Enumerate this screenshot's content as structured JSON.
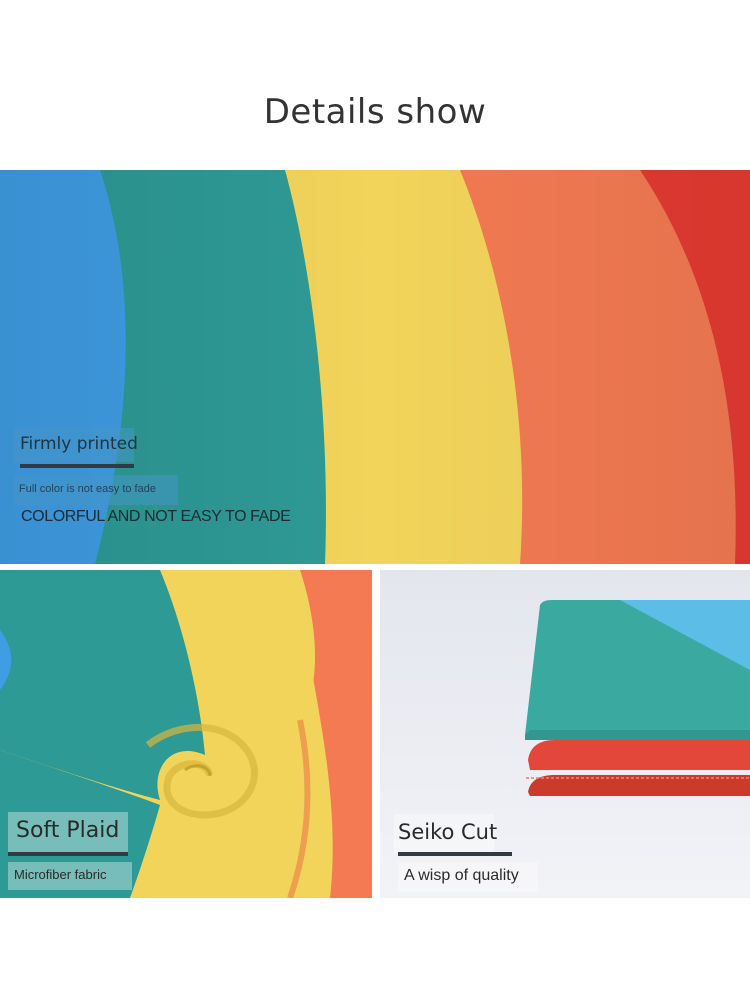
{
  "page": {
    "title": "Details show"
  },
  "hero": {
    "heading": "Firmly printed",
    "subheading": "Full color is not easy to fade",
    "tagline": "COLORFUL AND NOT EASY TO FADE",
    "colors": [
      "#3f9de4",
      "#2e9a96",
      "#f2d45b",
      "#f37a52",
      "#e43a31"
    ]
  },
  "swirl_panel": {
    "heading": "Soft Plaid",
    "subheading": "Microfiber fabric"
  },
  "folded_panel": {
    "heading": "Seiko Cut",
    "subheading": "A wisp of quality"
  }
}
